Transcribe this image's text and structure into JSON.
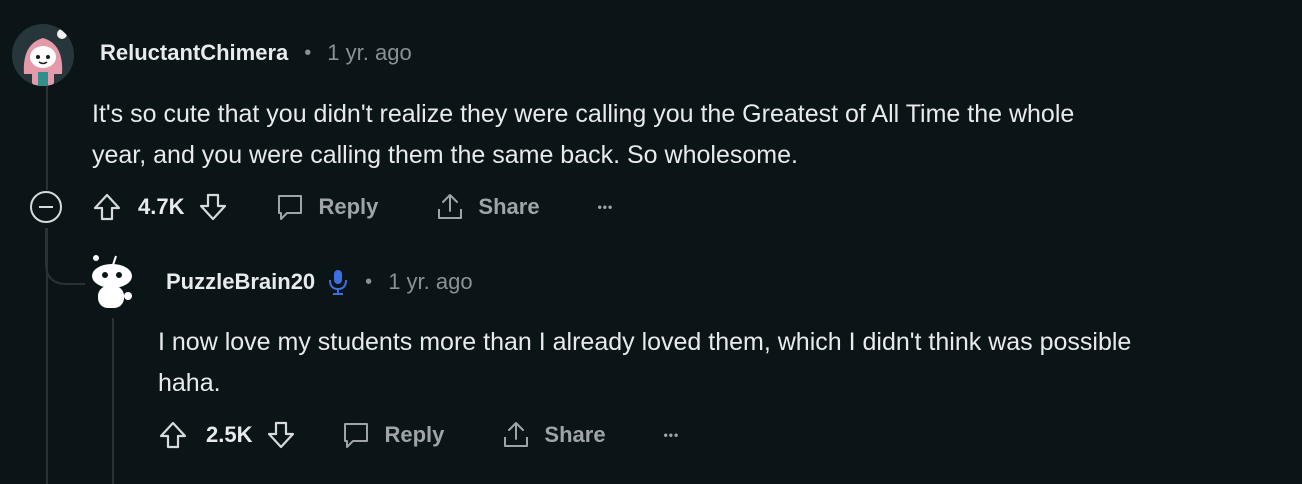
{
  "comments": [
    {
      "username": "ReluctantChimera",
      "separator": "•",
      "time": "1 yr. ago",
      "body_line1": "It's so cute that you didn't realize they were calling you the Greatest of All Time the whole",
      "body_line2": "year, and you were calling them the same back. So wholesome.",
      "score": "4.7K",
      "reply_label": "Reply",
      "share_label": "Share",
      "more_label": "•••"
    },
    {
      "username": "PuzzleBrain20",
      "separator": "•",
      "time": "1 yr. ago",
      "body_line1": "I now love my students more than I already loved them, which I didn't think was possible",
      "body_line2": "haha.",
      "score": "2.5K",
      "reply_label": "Reply",
      "share_label": "Share",
      "more_label": "•••"
    }
  ],
  "icons": {
    "upvote": "arrow-up-icon",
    "downvote": "arrow-down-icon",
    "reply": "speech-bubble-icon",
    "share": "share-icon",
    "collapse": "minus-circle-icon",
    "mic": "microphone-icon"
  },
  "colors": {
    "background": "#0b1416",
    "mic_badge": "#3d6fe0"
  }
}
